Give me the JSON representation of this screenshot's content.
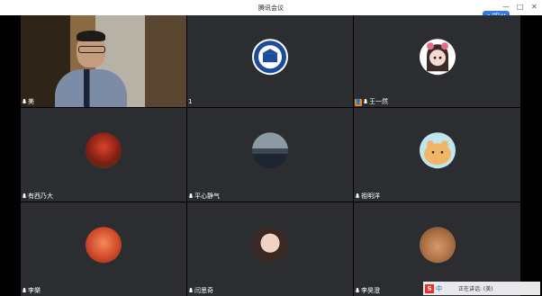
{
  "window": {
    "title": "腾讯会议",
    "minimize": "—",
    "maximize": "□",
    "close": "✕",
    "pill_label": "HD·••"
  },
  "participants": [
    {
      "name": "美",
      "type": "video",
      "active": true
    },
    {
      "name": "1",
      "type": "logo"
    },
    {
      "name": "王一然",
      "type": "avatar",
      "host": true
    },
    {
      "name": "有西乃大",
      "type": "avatar"
    },
    {
      "name": "平心静气",
      "type": "avatar"
    },
    {
      "name": "祖明洋",
      "type": "avatar"
    },
    {
      "name": "李樂",
      "type": "avatar"
    },
    {
      "name": "闫思奇",
      "type": "avatar"
    },
    {
      "name": "李昊澄",
      "type": "avatar"
    }
  ],
  "floating_bar": {
    "ime_logo": "S",
    "ime_mode": "中",
    "title": "正在讲话: (美)"
  },
  "colors": {
    "tile_bg": "#2b2d31",
    "active_border": "#2aa35a",
    "host_badge": "#f08a24"
  }
}
